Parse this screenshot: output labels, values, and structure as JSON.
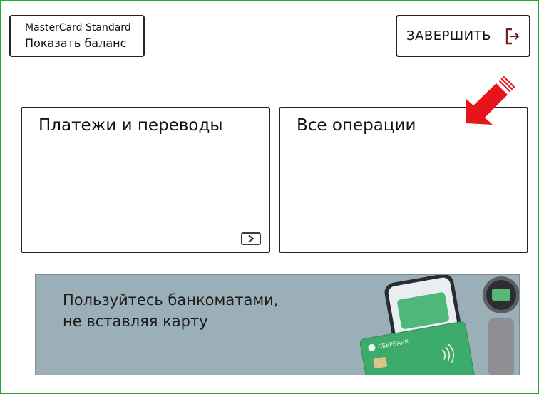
{
  "card": {
    "name": "MasterCard Standard",
    "show_balance_label": "Показать баланс"
  },
  "header": {
    "finish_label": "ЗАВЕРШИТЬ",
    "finish_icon": "exit-icon"
  },
  "tiles": [
    {
      "title": "Платежи и переводы",
      "icon": "chevron-right-icon"
    },
    {
      "title": "Все операции"
    }
  ],
  "banner": {
    "line1": "Пользуйтесь банкоматами,",
    "line2": "не вставляя карту",
    "card_logo_text": "СБЕРБАНК"
  },
  "colors": {
    "frame_border": "#1faa2b",
    "arrow_red": "#e8141b",
    "banner_bg": "#9aafb7",
    "card_green": "#3dab6a",
    "exit_icon": "#7a1f1f"
  }
}
